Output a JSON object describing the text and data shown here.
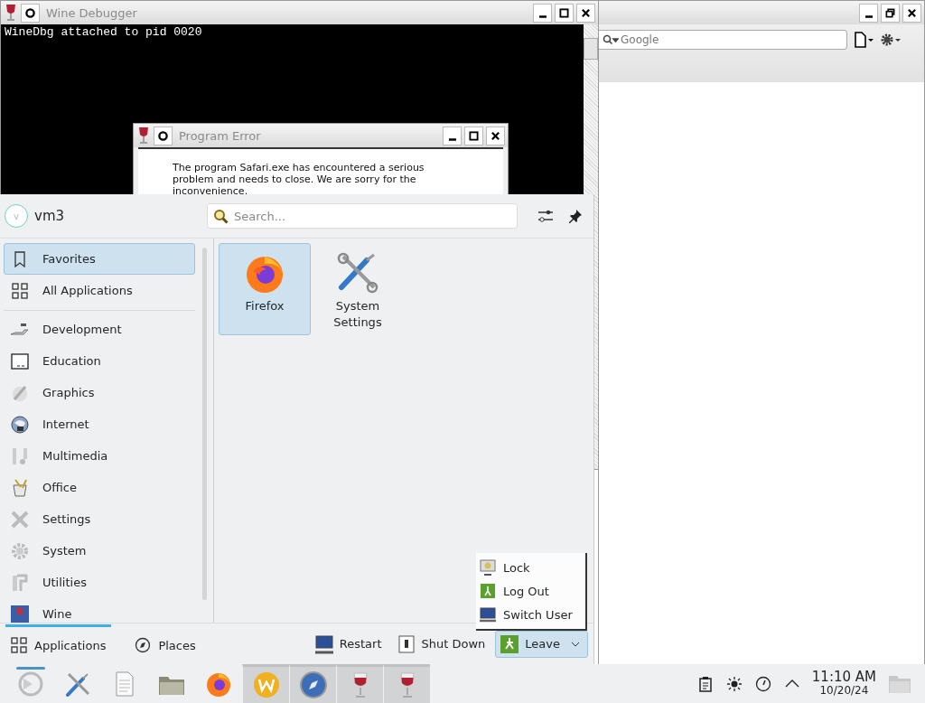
{
  "debugger_window": {
    "title": "Wine Debugger",
    "console_text": "WineDbg attached to pid 0020"
  },
  "error_dialog": {
    "title": "Program Error",
    "message": "The program Safari.exe has encountered a serious problem and needs to close. We are sorry for the inconvenience."
  },
  "browser_window": {
    "search": {
      "placeholder": "Google"
    }
  },
  "launcher": {
    "user": {
      "initial": "v",
      "name": "vm3"
    },
    "search": {
      "placeholder": "Search..."
    },
    "views": [
      {
        "label": "Favorites",
        "kind": "favorites",
        "selected": true
      },
      {
        "label": "All Applications",
        "kind": "grid",
        "selected": false
      }
    ],
    "categories": [
      {
        "label": "Development",
        "kind": "development"
      },
      {
        "label": "Education",
        "kind": "education"
      },
      {
        "label": "Graphics",
        "kind": "graphics"
      },
      {
        "label": "Internet",
        "kind": "internet"
      },
      {
        "label": "Multimedia",
        "kind": "multimedia"
      },
      {
        "label": "Office",
        "kind": "office"
      },
      {
        "label": "Settings",
        "kind": "settings"
      },
      {
        "label": "System",
        "kind": "system"
      },
      {
        "label": "Utilities",
        "kind": "utilities"
      },
      {
        "label": "Wine",
        "kind": "wine"
      }
    ],
    "apps": [
      {
        "label": "Firefox",
        "kind": "firefox",
        "selected": true
      },
      {
        "label": "System Settings",
        "kind": "tools",
        "selected": false
      }
    ],
    "tabs": [
      {
        "label": "Applications",
        "kind": "grid",
        "selected": true
      },
      {
        "label": "Places",
        "kind": "compass",
        "selected": false
      }
    ],
    "power_buttons": [
      {
        "label": "Restart",
        "kind": "restart",
        "expanded": false
      },
      {
        "label": "Shut Down",
        "kind": "shutdown",
        "expanded": false
      },
      {
        "label": "Leave",
        "kind": "leave",
        "expanded": true
      }
    ],
    "leave_menu": [
      {
        "label": "Lock",
        "kind": "lock"
      },
      {
        "label": "Log Out",
        "kind": "logout"
      },
      {
        "label": "Switch User",
        "kind": "switch"
      }
    ]
  },
  "taskbar": {
    "items": [
      {
        "kind": "activities",
        "task": false,
        "running": true
      },
      {
        "kind": "tools",
        "task": false,
        "running": false
      },
      {
        "kind": "document",
        "task": false,
        "running": false
      },
      {
        "kind": "folder",
        "task": false,
        "running": false
      },
      {
        "kind": "firefox",
        "task": false,
        "running": false
      },
      {
        "kind": "wordpress",
        "task": true,
        "running": false
      },
      {
        "kind": "safari",
        "task": true,
        "running": false
      },
      {
        "kind": "wine",
        "task": true,
        "running": false
      },
      {
        "kind": "wine",
        "task": true,
        "running": false
      }
    ],
    "tray": [
      {
        "kind": "clipboard"
      },
      {
        "kind": "brightness"
      },
      {
        "kind": "gauge"
      },
      {
        "kind": "caret"
      }
    ],
    "clock": {
      "time": "11:10 AM",
      "date": "10/20/24"
    }
  }
}
